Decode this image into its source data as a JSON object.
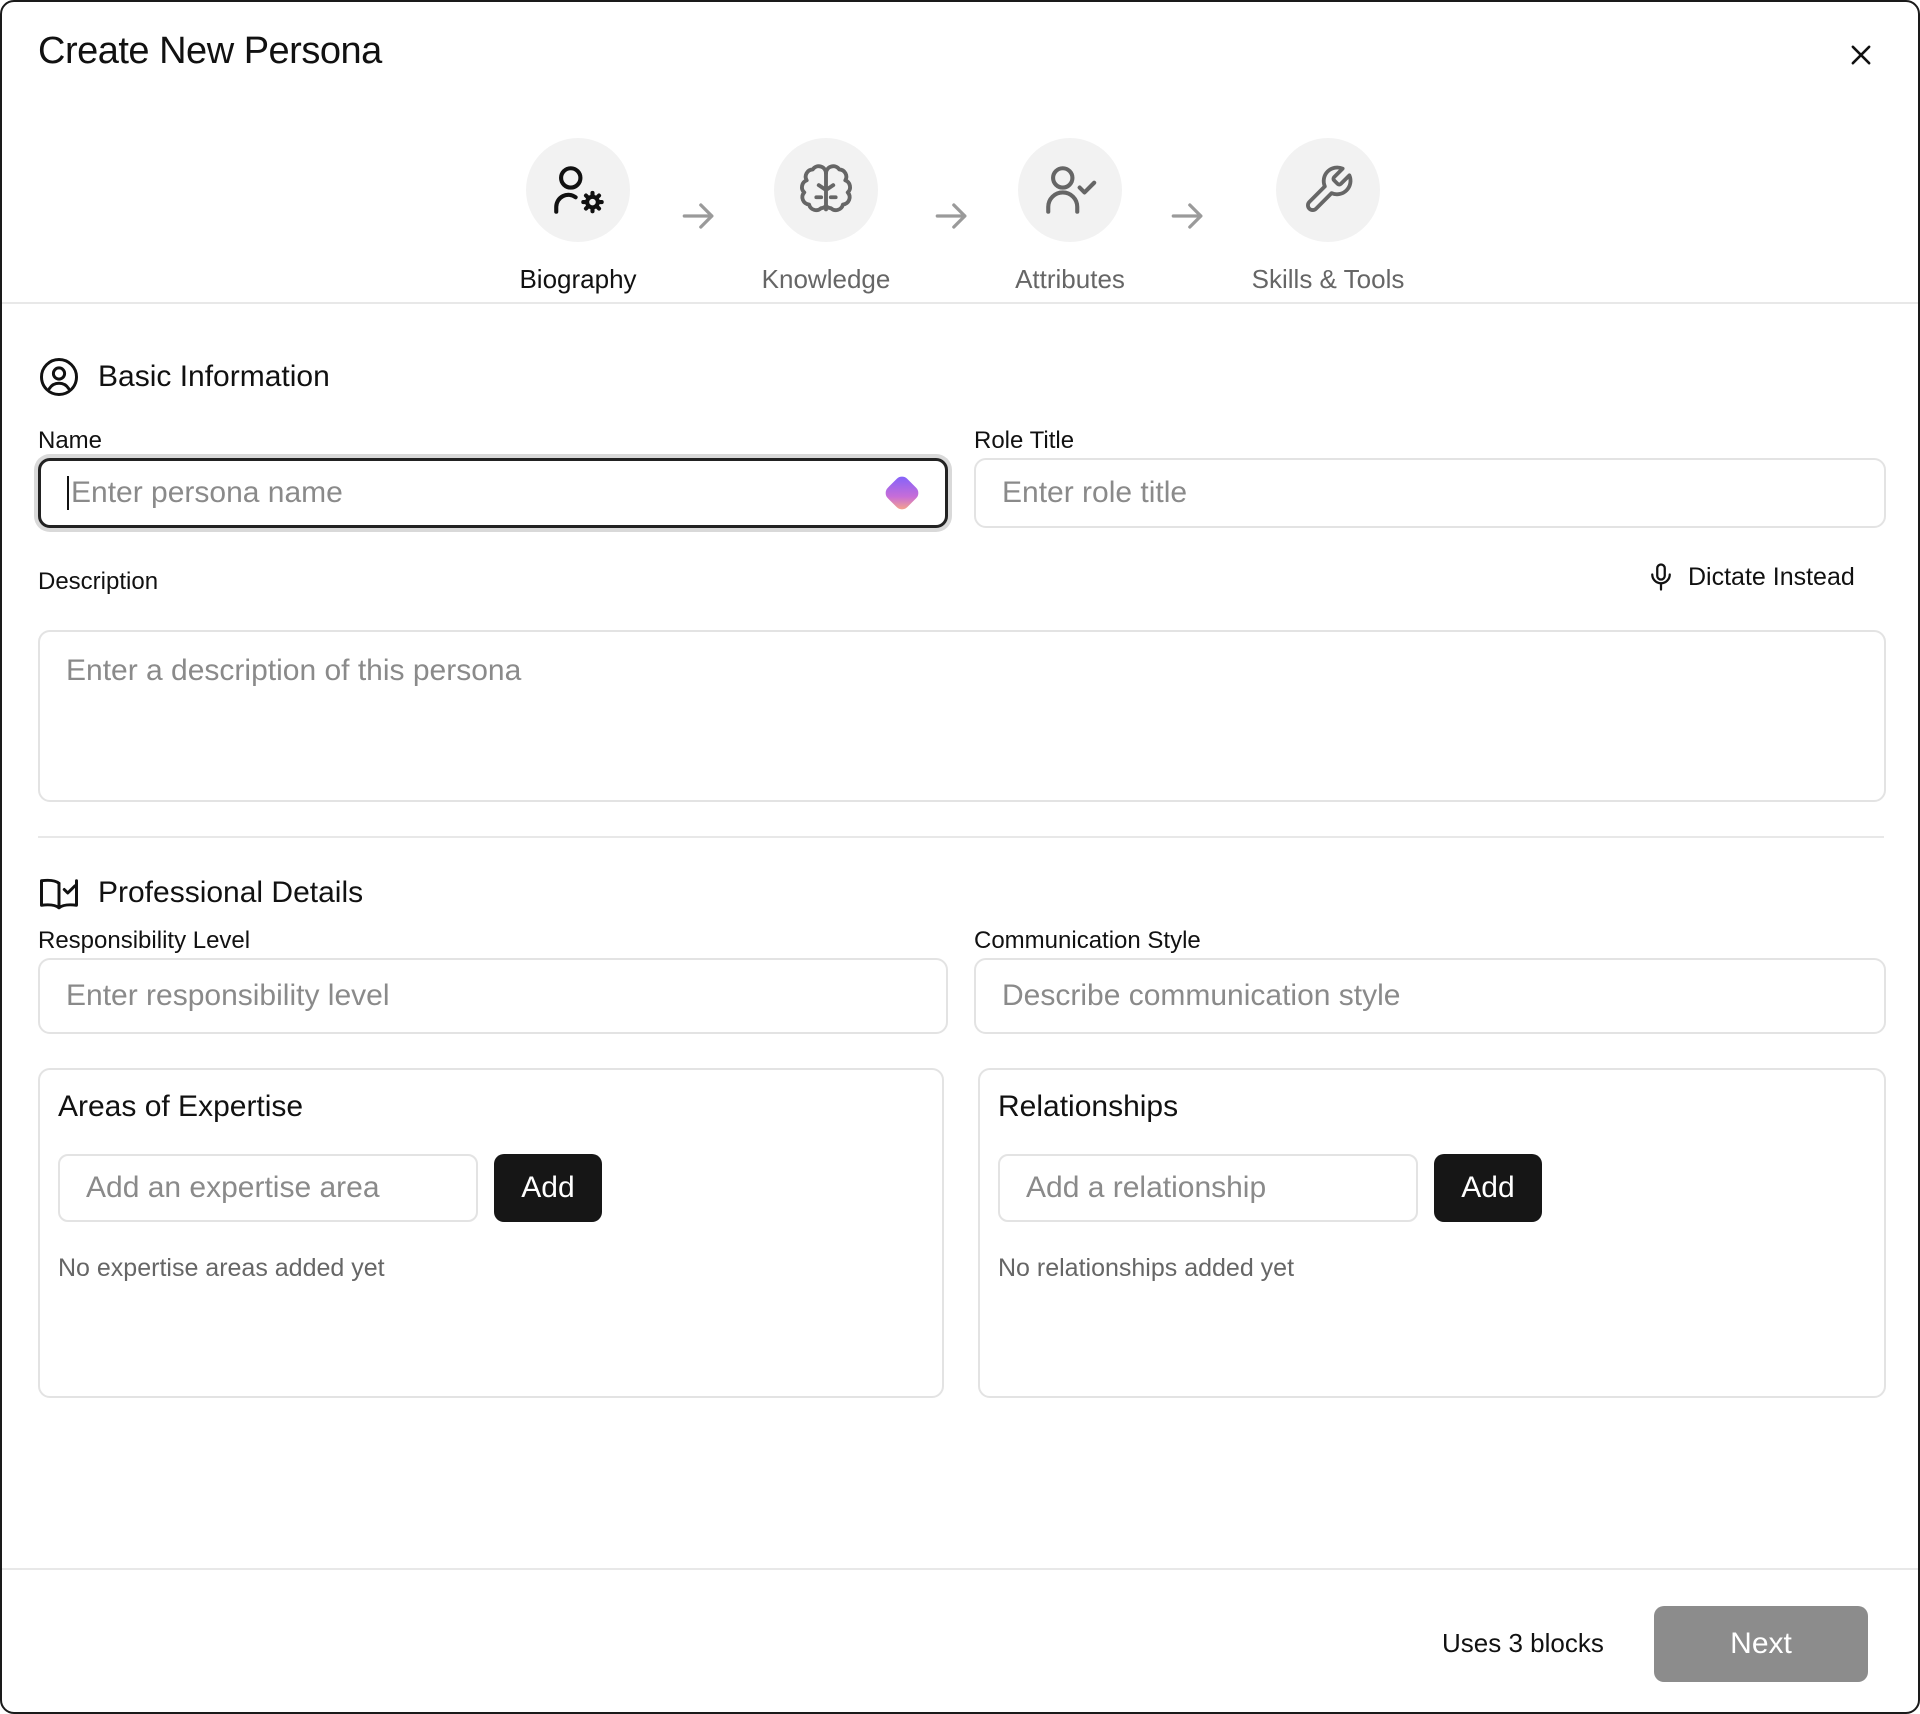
{
  "dialog": {
    "title": "Create New Persona",
    "close_icon": "close-icon"
  },
  "steps": [
    {
      "label": "Biography",
      "icon": "user-gear-icon",
      "active": true
    },
    {
      "label": "Knowledge",
      "icon": "brain-icon",
      "active": false
    },
    {
      "label": "Attributes",
      "icon": "user-check-icon",
      "active": false
    },
    {
      "label": "Skills & Tools",
      "icon": "wrench-icon",
      "active": false
    }
  ],
  "basic_info": {
    "heading": "Basic Information",
    "icon": "user-circle-icon",
    "name_label": "Name",
    "name_placeholder": "Enter persona name",
    "role_label": "Role Title",
    "role_placeholder": "Enter role title",
    "description_label": "Description",
    "dictate_label": "Dictate Instead",
    "description_placeholder": "Enter a description of this persona"
  },
  "professional": {
    "heading": "Professional Details",
    "icon": "book-check-icon",
    "responsibility_label": "Responsibility Level",
    "responsibility_placeholder": "Enter responsibility level",
    "communication_label": "Communication Style",
    "communication_placeholder": "Describe communication style"
  },
  "expertise": {
    "title": "Areas of Expertise",
    "input_placeholder": "Add an expertise area",
    "add_label": "Add",
    "empty_text": "No expertise areas added yet"
  },
  "relationships": {
    "title": "Relationships",
    "input_placeholder": "Add a relationship",
    "add_label": "Add",
    "empty_text": "No relationships added yet"
  },
  "footer": {
    "uses_text": "Uses 3 blocks",
    "next_label": "Next"
  },
  "colors": {
    "primary_button": "#161616",
    "disabled_button": "#8c8c8c",
    "border": "#e3e3e3",
    "placeholder": "#8a8a8a"
  }
}
